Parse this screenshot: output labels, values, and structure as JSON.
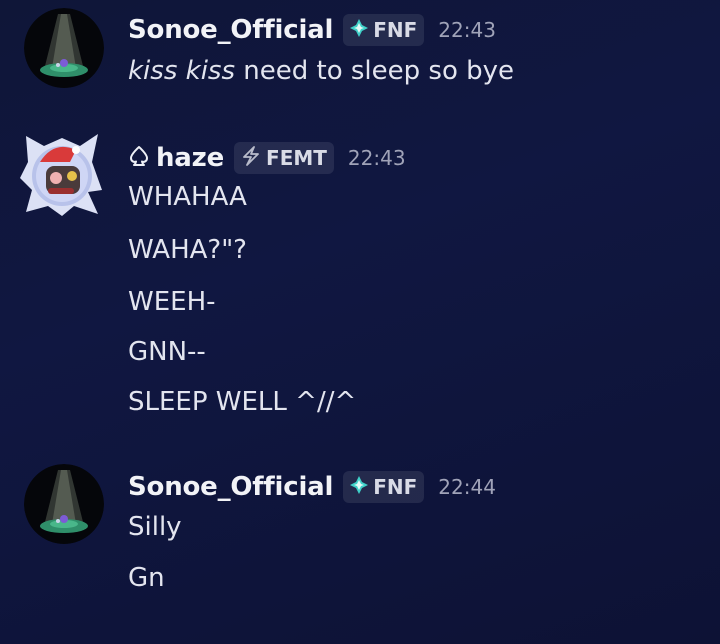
{
  "messages": [
    {
      "username": "Sonoe_Official",
      "tag": "FNF",
      "time": "22:43",
      "lines": [
        {
          "italic": "kiss kiss",
          "rest": " need to sleep so bye"
        }
      ]
    },
    {
      "username": "haze",
      "tag": "FEMT",
      "time": "22:43",
      "lines": [
        "WHAHAA",
        "WAHA?\"?",
        "WEEH-",
        "GNN--",
        "SLEEP WELL ^//^"
      ]
    },
    {
      "username": "Sonoe_Official",
      "tag": "FNF",
      "time": "22:44",
      "lines": [
        "Silly",
        "Gn"
      ]
    }
  ],
  "icons": {
    "fnf_tag_icon": "diamond-sparkle-icon",
    "femt_tag_icon": "lightning-icon",
    "role_icon": "spade-outline-icon"
  },
  "colors": {
    "background": "#0f1638",
    "tag_bg": "#2a3052",
    "fnf_icon": "#3fd1c9",
    "femt_icon": "#b9bccb"
  }
}
